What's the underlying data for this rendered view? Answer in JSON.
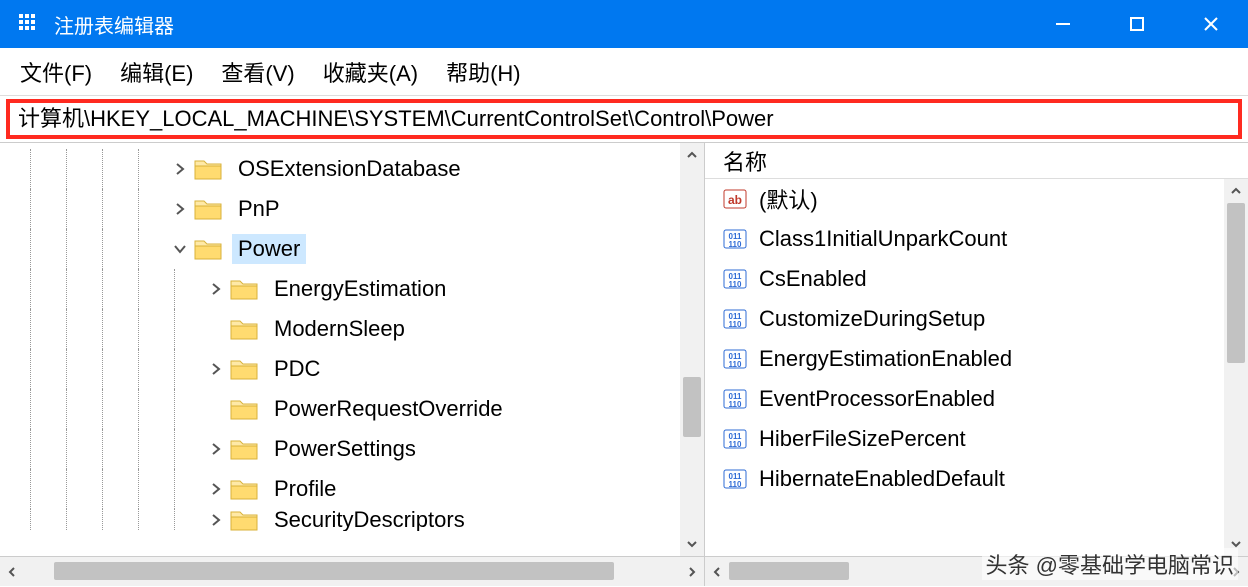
{
  "window": {
    "title": "注册表编辑器"
  },
  "menu": {
    "file": "文件(F)",
    "edit": "编辑(E)",
    "view": "查看(V)",
    "fav": "收藏夹(A)",
    "help": "帮助(H)"
  },
  "address": {
    "path": "计算机\\HKEY_LOCAL_MACHINE\\SYSTEM\\CurrentControlSet\\Control\\Power"
  },
  "tree": {
    "items": [
      {
        "label": "OSExtensionDatabase",
        "indent": 170,
        "expander": "closed"
      },
      {
        "label": "PnP",
        "indent": 170,
        "expander": "closed"
      },
      {
        "label": "Power",
        "indent": 170,
        "expander": "open",
        "selected": true
      },
      {
        "label": "EnergyEstimation",
        "indent": 206,
        "expander": "closed"
      },
      {
        "label": "ModernSleep",
        "indent": 206,
        "expander": "none"
      },
      {
        "label": "PDC",
        "indent": 206,
        "expander": "closed"
      },
      {
        "label": "PowerRequestOverride",
        "indent": 206,
        "expander": "none"
      },
      {
        "label": "PowerSettings",
        "indent": 206,
        "expander": "closed"
      },
      {
        "label": "Profile",
        "indent": 206,
        "expander": "closed"
      },
      {
        "label": "SecurityDescriptors",
        "indent": 206,
        "expander": "closed",
        "clipped": true
      }
    ]
  },
  "list": {
    "header_name": "名称",
    "items": [
      {
        "label": "(默认)",
        "type": "string"
      },
      {
        "label": "Class1InitialUnparkCount",
        "type": "binary"
      },
      {
        "label": "CsEnabled",
        "type": "binary"
      },
      {
        "label": "CustomizeDuringSetup",
        "type": "binary"
      },
      {
        "label": "EnergyEstimationEnabled",
        "type": "binary"
      },
      {
        "label": "EventProcessorEnabled",
        "type": "binary"
      },
      {
        "label": "HiberFileSizePercent",
        "type": "binary"
      },
      {
        "label": "HibernateEnabledDefault",
        "type": "binary"
      }
    ]
  },
  "watermark": "头条 @零基础学电脑常识"
}
